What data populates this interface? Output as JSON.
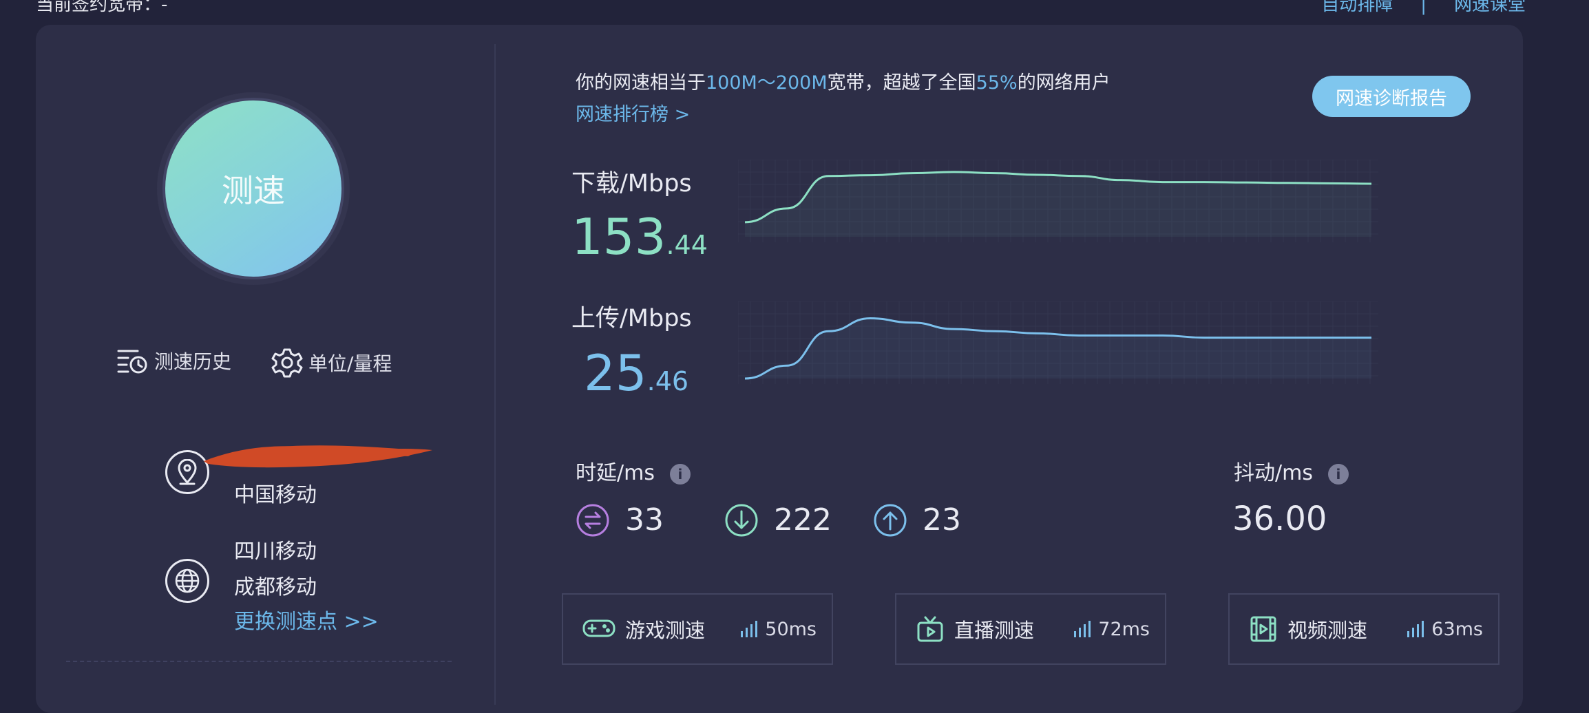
{
  "topbar": {
    "bandwidth_label": "当前签约宽带：-",
    "auto_diagnose": "自动排障",
    "separator": "|",
    "speed_class": "网速课堂"
  },
  "left": {
    "speed_button_label": "测速",
    "history_label": "测速历史",
    "units_label": "单位/量程",
    "isp_label": "中国移动",
    "server_line1": "四川移动",
    "server_line2": "成都移动",
    "change_server": "更换测速点 >>"
  },
  "summary": {
    "prefix": "你的网速相当于",
    "bandwidth_range": "100M～200M",
    "middle": "宽带，超越了全国",
    "percent": "55%",
    "suffix": "的网络用户",
    "rank_link": "网速排行榜 >",
    "report_button": "网速诊断报告"
  },
  "download": {
    "label": "下载/Mbps",
    "int": "153",
    "dec": ".44",
    "color": "#8de0c4",
    "trend": [
      36,
      70,
      150,
      152,
      157,
      160,
      157,
      153,
      150,
      140,
      135,
      135,
      134,
      133,
      132,
      131
    ]
  },
  "upload": {
    "label": "上传/Mbps",
    "int": "25",
    "dec": ".46",
    "color": "#7cc0ec",
    "trend": [
      0,
      6,
      22,
      28,
      26,
      23,
      22,
      21,
      20,
      20,
      20,
      19,
      19,
      19,
      19,
      19
    ]
  },
  "latency": {
    "label": "时延/ms",
    "idle": "33",
    "download": "222",
    "upload": "23",
    "idle_color": "#b67fe0",
    "download_color": "#8de0c4",
    "upload_color": "#7cc0ec"
  },
  "jitter": {
    "label": "抖动/ms",
    "value": "36.00"
  },
  "subtests": [
    {
      "name": "游戏测速",
      "ms": "50ms",
      "icon": "gamepad-icon"
    },
    {
      "name": "直播测速",
      "ms": "72ms",
      "icon": "tv-icon"
    },
    {
      "name": "视频测速",
      "ms": "63ms",
      "icon": "video-icon"
    }
  ],
  "info_glyph": "i"
}
